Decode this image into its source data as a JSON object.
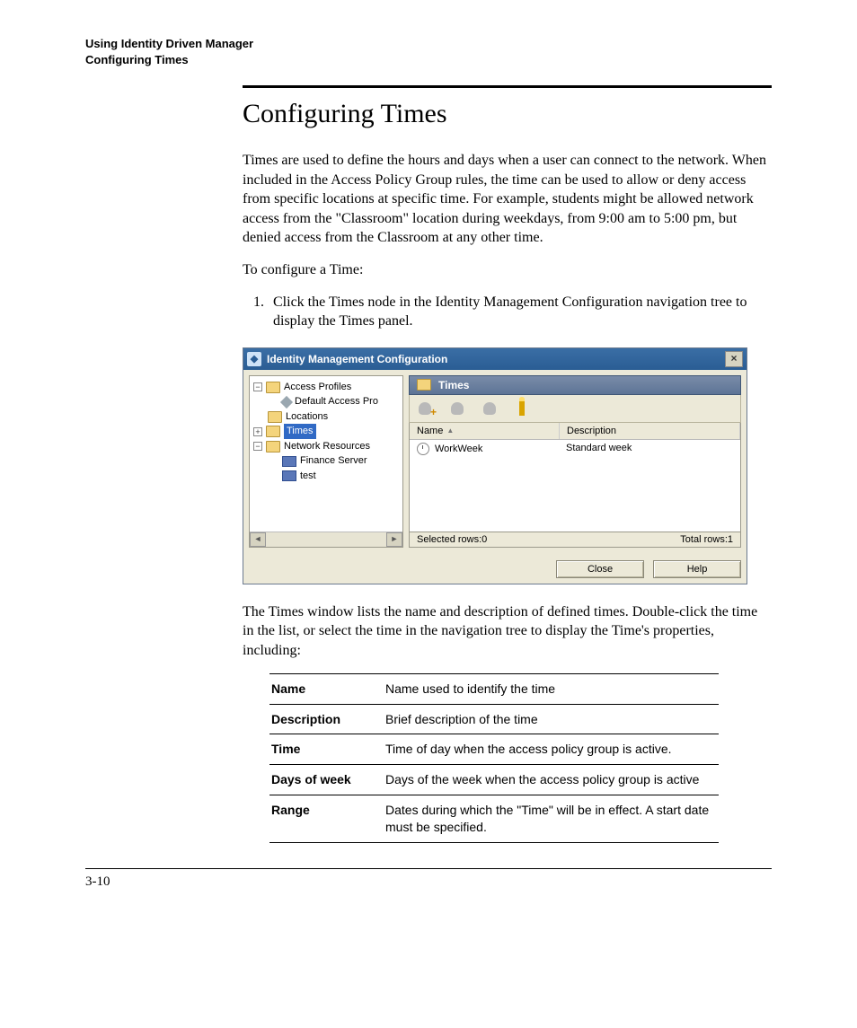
{
  "running_head": {
    "line1": "Using Identity Driven Manager",
    "line2": "Configuring Times"
  },
  "heading": "Configuring Times",
  "intro": "Times are used to define the hours and days when a user can connect to the network. When included in the Access Policy Group rules, the time can be used to allow or deny access from specific locations at specific time. For example, students might be allowed network access from the \"Classroom\" location during weekdays, from 9:00 am to 5:00 pm, but denied access from the Classroom at any other time.",
  "lead_in": "To configure a Time:",
  "step1": "Click the Times node in the Identity Management Configuration navigation tree to display the Times panel.",
  "screenshot": {
    "title": "Identity Management Configuration",
    "tree": {
      "access_profiles": "Access Profiles",
      "default_access": "Default Access Pro",
      "locations": "Locations",
      "times": "Times",
      "network_resources": "Network Resources",
      "finance_server": "Finance Server",
      "test": "test"
    },
    "panel_title": "Times",
    "grid": {
      "col_name": "Name",
      "col_desc": "Description",
      "row_name": "WorkWeek",
      "row_desc": "Standard week"
    },
    "status_left": "Selected rows:0",
    "status_right": "Total rows:1",
    "btn_close": "Close",
    "btn_help": "Help"
  },
  "after_shot": "The Times window lists the name and description of defined times. Double-click the time in the list, or select the time in the navigation tree to display the Time's properties, including:",
  "properties": [
    {
      "label": "Name",
      "desc": "Name used to identify the time"
    },
    {
      "label": "Description",
      "desc": "Brief description of the time"
    },
    {
      "label": "Time",
      "desc": "Time of day when the access policy group is active."
    },
    {
      "label": "Days of week",
      "desc": "Days of the week when the access policy group is active"
    },
    {
      "label": "Range",
      "desc": "Dates during which the \"Time\" will be in effect. A start date must be specified."
    }
  ],
  "page_number": "3-10"
}
